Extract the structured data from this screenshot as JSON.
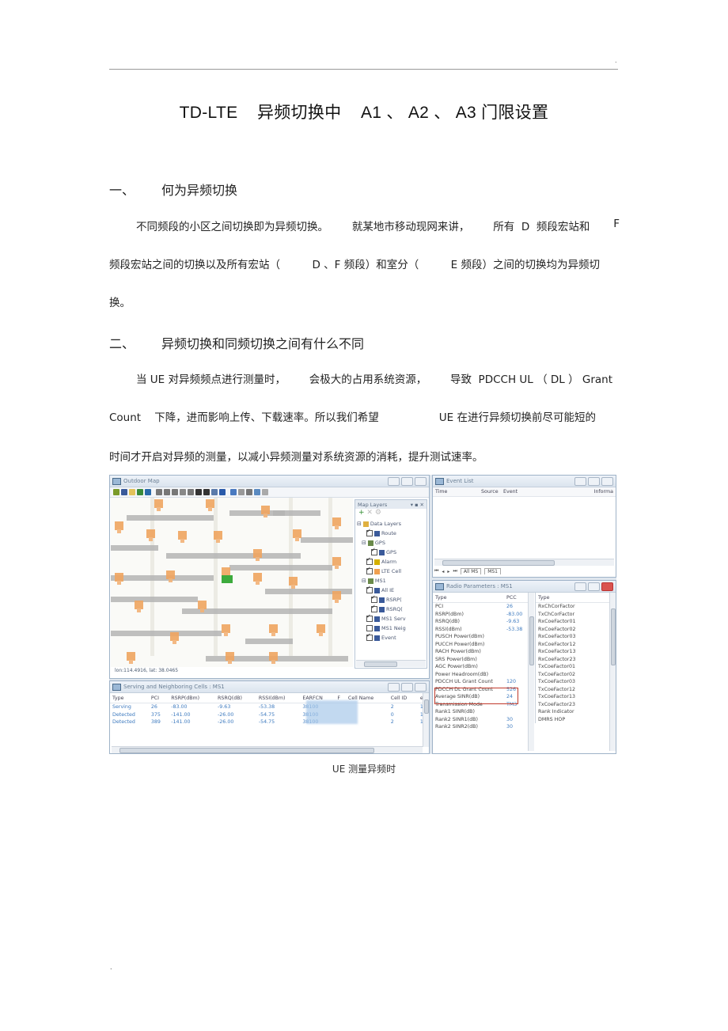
{
  "header": {
    "corner_mark": "."
  },
  "doc": {
    "title": "TD-LTE    异频切换中    A1 、 A2 、 A3 门限设置",
    "sections": [
      {
        "number": "一、",
        "heading": "何为异频切换",
        "paragraph_lines": [
          [
            "不同频段的小区之间切换即为异频切换。",
            "就某地市移动现网来讲，",
            "所有  D  频段宏站和",
            "F"
          ],
          [
            "频段宏站之间的切换以及所有宏站（",
            "D 、F 频段）和室分（",
            "E 频段）之间的切换均为异频切"
          ],
          [
            "换。"
          ]
        ]
      },
      {
        "number": "二、",
        "heading": "异频切换和同频切换之间有什么不同",
        "paragraph_lines": [
          [
            "当 UE 对异频频点进行测量时，",
            "会极大的占用系统资源，",
            "导致  PDCCH UL （ DL ） Grant"
          ],
          [
            "Count    下降，进而影响上传、下载速率。所以我们希望",
            "UE 在进行异频切换前尽可能短的"
          ],
          [
            "时间才开启对异频的测量，以减小异频测量对系统资源的消耗，提升测试速率。"
          ]
        ]
      }
    ],
    "figure_caption": "UE 测量异频时",
    "footer_mark": "."
  },
  "figure": {
    "outdoor_map": {
      "title": "Outdoor Map",
      "coords": "lon:114.4916, lat: 38.0465",
      "toolbar_icons": [
        "open-icon",
        "save-icon",
        "layer-icon",
        "stack-icon",
        "search-icon",
        "zoom-in-icon",
        "zoom-out-icon",
        "zoom-rect-icon",
        "pan-icon",
        "measure-icon",
        "pin-icon",
        "pin-line-icon",
        "table-icon",
        "globe-icon",
        "select-icon",
        "grid-icon",
        "fill-icon",
        "add-icon",
        "doc-icon"
      ],
      "layers_panel": {
        "title": "Map Layers",
        "items": [
          {
            "label": "Data Layers",
            "checked": null
          },
          {
            "label": "Route",
            "checked": true
          },
          {
            "label": "GPS",
            "checked": null
          },
          {
            "label": "GPS",
            "checked": true
          },
          {
            "label": "Alarm",
            "checked": true
          },
          {
            "label": "LTE Cell",
            "checked": true
          },
          {
            "label": "MS1",
            "checked": null
          },
          {
            "label": "All IE",
            "checked": true
          },
          {
            "label": "RSRP(",
            "checked": true
          },
          {
            "label": "RSRQ(",
            "checked": true
          },
          {
            "label": "MS1 Serv",
            "checked": true
          },
          {
            "label": "MS1 Neig",
            "checked": false
          },
          {
            "label": "Event",
            "checked": true
          }
        ]
      }
    },
    "event_list": {
      "title": "Event List",
      "columns": [
        "Time",
        "Source",
        "Event",
        "Informa"
      ],
      "tabs": [
        "All MS",
        "MS1"
      ]
    },
    "radio_params": {
      "title": "Radio Parameters : MS1",
      "left_columns": [
        "Type",
        "PCC"
      ],
      "left_rows": [
        [
          "PCI",
          "26"
        ],
        [
          "RSRP(dBm)",
          "-83.00"
        ],
        [
          "RSRQ(dB)",
          "-9.63"
        ],
        [
          "RSSI(dBm)",
          "-53.38"
        ],
        [
          "PUSCH Power(dBm)",
          ""
        ],
        [
          "PUCCH Power(dBm)",
          ""
        ],
        [
          "RACH Power(dBm)",
          ""
        ],
        [
          "SRS Power(dBm)",
          ""
        ],
        [
          "AGC Power(dBm)",
          ""
        ],
        [
          "Power Headroom(dB)",
          ""
        ],
        [
          "PDCCH UL Grant Count",
          "120"
        ],
        [
          "PDCCH DL Grant Count",
          "526"
        ],
        [
          "Average SINR(dB)",
          "24"
        ],
        [
          "Transmission Mode",
          "TM3"
        ],
        [
          "Rank1 SINR(dB)",
          ""
        ],
        [
          "Rank2 SINR1(dB)",
          "30"
        ],
        [
          "Rank2 SINR2(dB)",
          "30"
        ]
      ],
      "right_column": "Type",
      "right_rows": [
        "RxChCorFactor",
        "TxChCorFactor",
        "RxCoeFactor01",
        "RxCoeFactor02",
        "RxCoeFactor03",
        "RxCoeFactor12",
        "RxCoeFactor13",
        "RxCoeFactor23",
        "TxCoeFactor01",
        "TxCoeFactor02",
        "TxCoeFactor03",
        "TxCoeFactor12",
        "TxCoeFactor13",
        "TxCoeFactor23",
        "Rank Indicator",
        "DMRS HOP"
      ]
    },
    "serving_cells": {
      "title": "Serving and Neighboring Cells : MS1",
      "columns": [
        "Type",
        "PCI",
        "RSRP(dBm)",
        "RSRQ(dB)",
        "RSSI(dBm)",
        "EARFCN",
        "F",
        "Cell Name",
        "Cell ID",
        "e"
      ],
      "rows": [
        [
          "Serving",
          "26",
          "-83.00",
          "-9.63",
          "-53.38",
          "38100",
          "",
          "",
          "2",
          "1"
        ],
        [
          "Detected",
          "375",
          "-141.00",
          "-26.00",
          "-54.75",
          "38100",
          "",
          "",
          "0",
          "1"
        ],
        [
          "Detected",
          "389",
          "-141.00",
          "-26.00",
          "-54.75",
          "38100",
          "",
          "",
          "2",
          "1"
        ]
      ]
    }
  }
}
